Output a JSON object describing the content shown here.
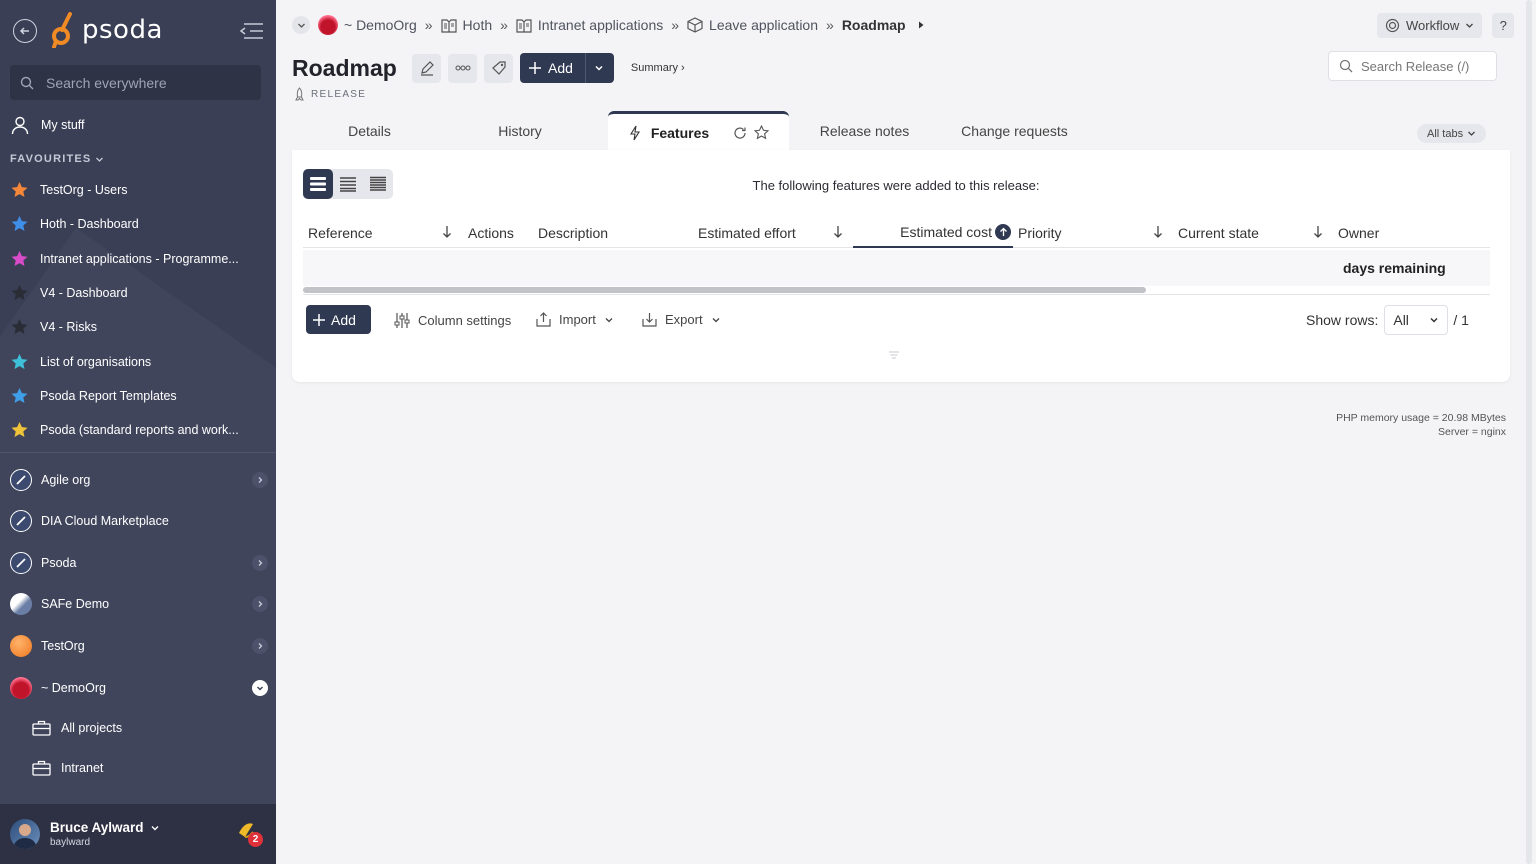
{
  "app": {
    "logo_text": "psoda",
    "brand_color": "#3a3f55",
    "accent_color": "#f08a24"
  },
  "sidebar": {
    "search_placeholder": "Search everywhere",
    "my_stuff": "My stuff",
    "favourites_heading": "FAVOURITES",
    "favourites": [
      {
        "label": "TestOrg - Users",
        "color": "#f5873a"
      },
      {
        "label": "Hoth - Dashboard",
        "color": "#3f8fe8"
      },
      {
        "label": "Intranet applications - Programme...",
        "color": "#d84cc9"
      },
      {
        "label": "V4 - Dashboard",
        "color": "#2a2c36"
      },
      {
        "label": "V4 - Risks",
        "color": "#2a2c36"
      },
      {
        "label": "List of organisations",
        "color": "#3ec0d8"
      },
      {
        "label": "Psoda Report Templates",
        "color": "#3f9fe8"
      },
      {
        "label": "Psoda (standard reports and work...",
        "color": "#f0c43a"
      }
    ],
    "orgs": [
      {
        "label": "Agile org",
        "expandable": true
      },
      {
        "label": "DIA Cloud Marketplace",
        "expandable": false
      },
      {
        "label": "Psoda",
        "expandable": true
      },
      {
        "label": "SAFe Demo",
        "expandable": true
      },
      {
        "label": "TestOrg",
        "expandable": true
      },
      {
        "label": "~ DemoOrg",
        "expandable": true,
        "open": true
      }
    ],
    "sub_items": [
      "All projects",
      "Intranet"
    ],
    "user": {
      "name": "Bruce Aylward",
      "login": "baylward",
      "notifications": "2"
    }
  },
  "breadcrumb": {
    "items": [
      "~ DemoOrg",
      "Hoth",
      "Intranet applications",
      "Leave application",
      "Roadmap"
    ],
    "separator": "»"
  },
  "header": {
    "workflow_label": "Workflow",
    "help_label": "?",
    "title": "Roadmap",
    "type_label": "RELEASE",
    "add_label": "Add",
    "summary_link": "Summary ›",
    "search_placeholder": "Search Release (/)"
  },
  "tabs": {
    "items": [
      "Details",
      "History",
      "Features",
      "Release notes",
      "Change requests"
    ],
    "active": "Features",
    "all_tabs": "All tabs"
  },
  "features": {
    "info": "The following features were added to this release:",
    "columns": [
      "Reference",
      "Actions",
      "Description",
      "Estimated effort",
      "Estimated cost",
      "Priority",
      "Current state",
      "Owner"
    ],
    "row_text": "days remaining",
    "add_label": "Add",
    "column_settings": "Column settings",
    "import_label": "Import",
    "export_label": "Export",
    "show_rows_label": "Show rows:",
    "show_rows_value": "All",
    "page_total": "/ 1"
  },
  "footer": {
    "memory": "PHP memory usage = 20.98 MBytes",
    "server": "Server = nginx"
  }
}
